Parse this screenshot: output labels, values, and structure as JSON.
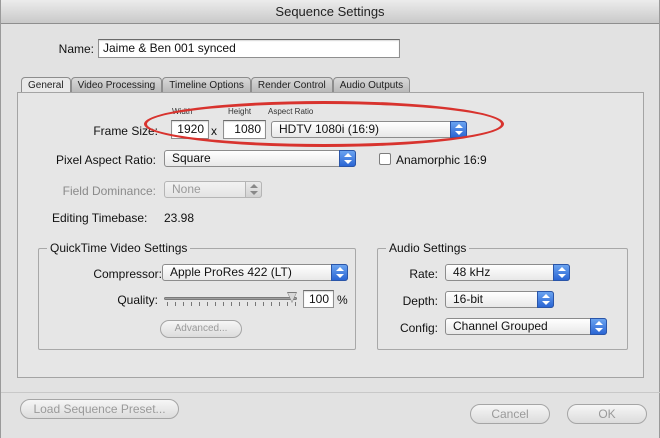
{
  "window": {
    "title": "Sequence Settings"
  },
  "name_field": {
    "label": "Name:",
    "value": "Jaime & Ben 001 synced"
  },
  "tabs": [
    {
      "label": "General",
      "active": true
    },
    {
      "label": "Video Processing"
    },
    {
      "label": "Timeline Options"
    },
    {
      "label": "Render Control"
    },
    {
      "label": "Audio Outputs"
    }
  ],
  "general": {
    "frame_size": {
      "label": "Frame Size:",
      "width_caption": "Width",
      "height_caption": "Height",
      "aspect_caption": "Aspect Ratio",
      "width": "1920",
      "x_separator": "x",
      "height": "1080",
      "aspect_ratio": "HDTV 1080i (16:9)"
    },
    "pixel_aspect": {
      "label": "Pixel Aspect Ratio:",
      "value": "Square"
    },
    "anamorphic": {
      "label": "Anamorphic 16:9",
      "checked": false
    },
    "field_dominance": {
      "label": "Field Dominance:",
      "value": "None",
      "enabled": false
    },
    "editing_timebase": {
      "label": "Editing Timebase:",
      "value": "23.98"
    },
    "quicktime": {
      "title": "QuickTime Video Settings",
      "compressor_label": "Compressor:",
      "compressor_value": "Apple ProRes 422 (LT)",
      "quality_label": "Quality:",
      "quality_value": "100",
      "quality_unit": "%",
      "quality_fraction": 1.0,
      "advanced_button": "Advanced..."
    },
    "audio": {
      "title": "Audio Settings",
      "rate_label": "Rate:",
      "rate_value": "48 kHz",
      "depth_label": "Depth:",
      "depth_value": "16-bit",
      "config_label": "Config:",
      "config_value": "Channel Grouped"
    }
  },
  "footer": {
    "load_preset": "Load Sequence Preset...",
    "cancel": "Cancel",
    "ok": "OK"
  },
  "colors": {
    "highlight_ellipse": "#d8332e",
    "popup_arrow_blue": "#2b66d4"
  }
}
